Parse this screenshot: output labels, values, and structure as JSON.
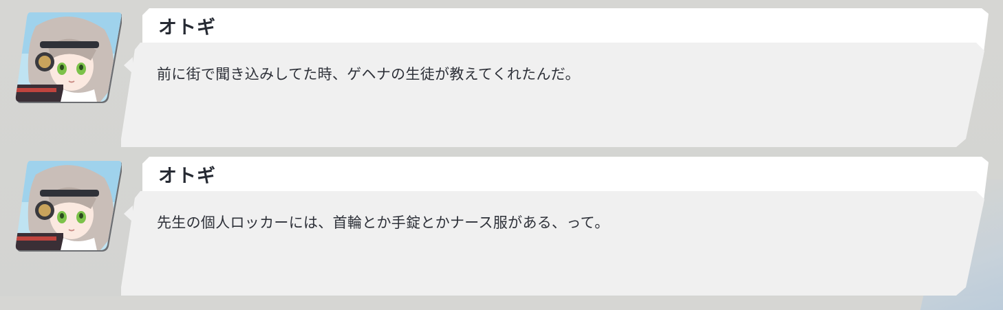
{
  "messages": [
    {
      "speaker": "オトギ",
      "text": "前に街で聞き込みしてた時、ゲヘナの生徒が教えてくれたんだ。",
      "avatar_icon": "character-portrait"
    },
    {
      "speaker": "オトギ",
      "text": "先生の個人ロッカーには、首輪とか手錠とかナース服がある、って。",
      "avatar_icon": "character-portrait"
    }
  ],
  "colors": {
    "background": "#d5d5d3",
    "name_plate": "#ffffff",
    "bubble": "#f0f0f0",
    "text": "#2d3038",
    "name_text": "#262a33"
  }
}
